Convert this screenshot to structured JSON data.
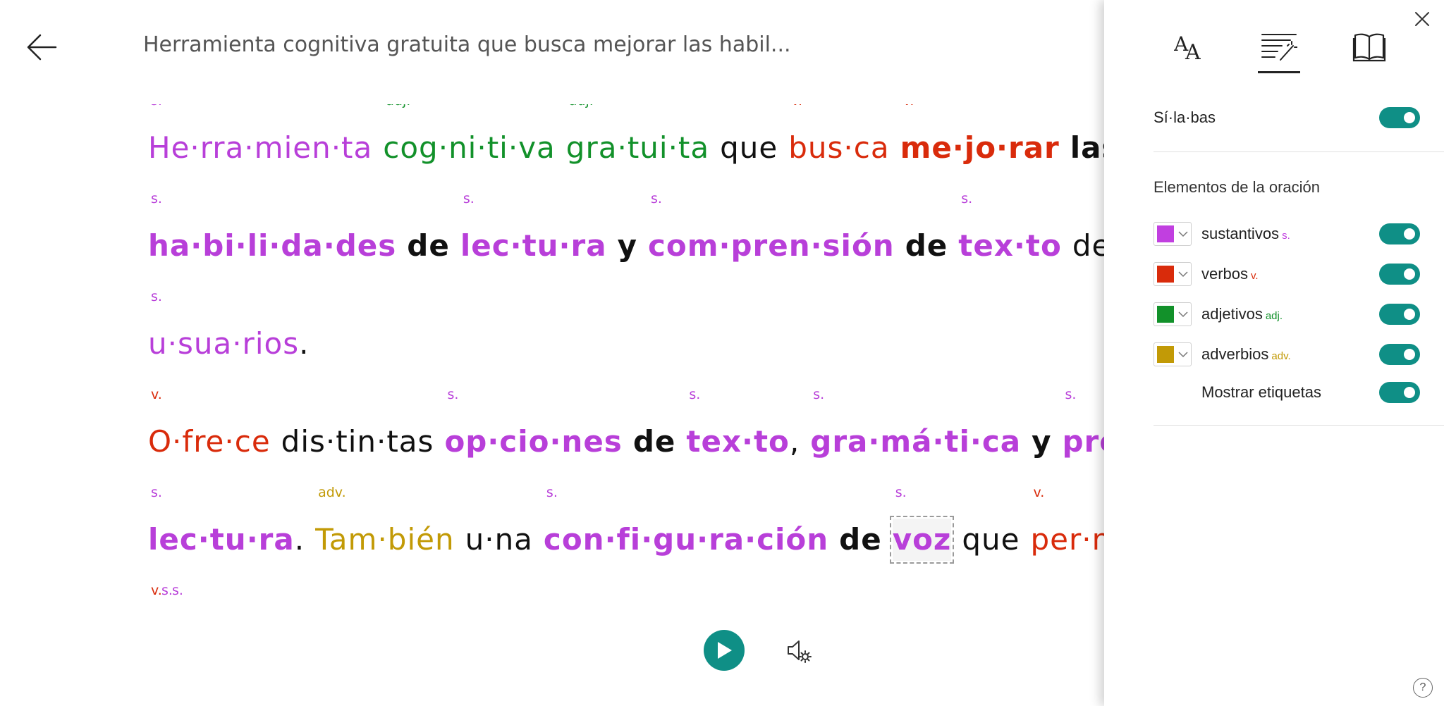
{
  "header": {
    "title": "Herramienta cognitiva gratuita que busca mejorar las habil..."
  },
  "reader": {
    "lines": [
      [
        {
          "text": "He·rra·mien·ta",
          "tag": "s.",
          "cls": "noun"
        },
        {
          "text": "cog·ni·ti·va",
          "tag": "adj.",
          "cls": "adj"
        },
        {
          "text": "gra·tui·ta",
          "tag": "adj.",
          "cls": "adj"
        },
        {
          "text": "que",
          "tag": "",
          "cls": "plain"
        },
        {
          "text": "bus·ca",
          "tag": "v.",
          "cls": "verb"
        },
        {
          "text": "me·jo·rar",
          "tag": "v.",
          "cls": "verb bold"
        },
        {
          "text": "las",
          "tag": "",
          "cls": "plain bold"
        }
      ],
      [
        {
          "text": "ha·bi·li·da·des",
          "tag": "s.",
          "cls": "noun bold"
        },
        {
          "text": "de",
          "tag": "",
          "cls": "plain bold"
        },
        {
          "text": "lec·tu·ra",
          "tag": "s.",
          "cls": "noun bold"
        },
        {
          "text": "y",
          "tag": "",
          "cls": "plain bold"
        },
        {
          "text": "com·pren·sión",
          "tag": "s.",
          "cls": "noun bold"
        },
        {
          "text": "de",
          "tag": "",
          "cls": "plain bold"
        },
        {
          "text": "tex·to",
          "tag": "s.",
          "cls": "noun bold"
        },
        {
          "text": "de to·d",
          "tag": "",
          "cls": "plain"
        }
      ],
      [
        {
          "text": "u·sua·rios",
          "tag": "s.",
          "cls": "noun",
          "after": "."
        }
      ],
      [
        {
          "text": "O·fre·ce",
          "tag": "v.",
          "cls": "verb"
        },
        {
          "text": "dis·tin·tas",
          "tag": "",
          "cls": "plain"
        },
        {
          "text": "op·cio·nes",
          "tag": "s.",
          "cls": "noun bold"
        },
        {
          "text": "de",
          "tag": "",
          "cls": "plain bold"
        },
        {
          "text": "tex·to",
          "tag": "s.",
          "cls": "noun bold",
          "after": ","
        },
        {
          "text": "gra·má·ti·ca",
          "tag": "s.",
          "cls": "noun bold"
        },
        {
          "text": "y",
          "tag": "",
          "cls": "plain bold"
        },
        {
          "text": "pre·fe",
          "tag": "s.",
          "cls": "noun bold"
        }
      ],
      [
        {
          "text": "lec·tu·ra",
          "tag": "s.",
          "cls": "noun bold",
          "after": "."
        },
        {
          "text": "Tam·bién",
          "tag": "adv.",
          "cls": "adv"
        },
        {
          "text": "u·na",
          "tag": "",
          "cls": "plain"
        },
        {
          "text": "con·fi·gu·ra·ción",
          "tag": "s.",
          "cls": "noun bold"
        },
        {
          "text": "de",
          "tag": "",
          "cls": "plain bold"
        },
        {
          "text": "voz",
          "tag": "s.",
          "cls": "noun bold selected-word"
        },
        {
          "text": "que",
          "tag": "",
          "cls": "plain"
        },
        {
          "text": "per·mi·",
          "tag": "v.",
          "cls": "verb"
        }
      ],
      [
        {
          "text": "    ",
          "tag": "v.",
          "cls": "verb"
        },
        {
          "text": "          ",
          "tag": "s.",
          "cls": "noun"
        },
        {
          "text": "        ",
          "tag": "s.",
          "cls": "noun"
        }
      ]
    ]
  },
  "controls": {
    "play_icon": "play-icon",
    "voice_icon": "voice-settings-icon"
  },
  "panel": {
    "tabs": [
      {
        "name": "text-preferences",
        "icon": "text-size-icon"
      },
      {
        "name": "grammar-options",
        "icon": "grammar-wand-icon",
        "active": true
      },
      {
        "name": "reading-preferences",
        "icon": "book-icon"
      }
    ],
    "syllables_label": "Sí·la·bas",
    "section_title": "Elementos de la oración",
    "parts": [
      {
        "label": "sustantivos",
        "suffix": "s.",
        "color": "#c13fe0"
      },
      {
        "label": "verbos",
        "suffix": "v.",
        "color": "#d92b0b"
      },
      {
        "label": "adjetivos",
        "suffix": "adj.",
        "color": "#12912a"
      },
      {
        "label": "adverbios",
        "suffix": "adv.",
        "color": "#c29a06"
      }
    ],
    "show_labels": "Mostrar etiquetas",
    "help": "?"
  }
}
